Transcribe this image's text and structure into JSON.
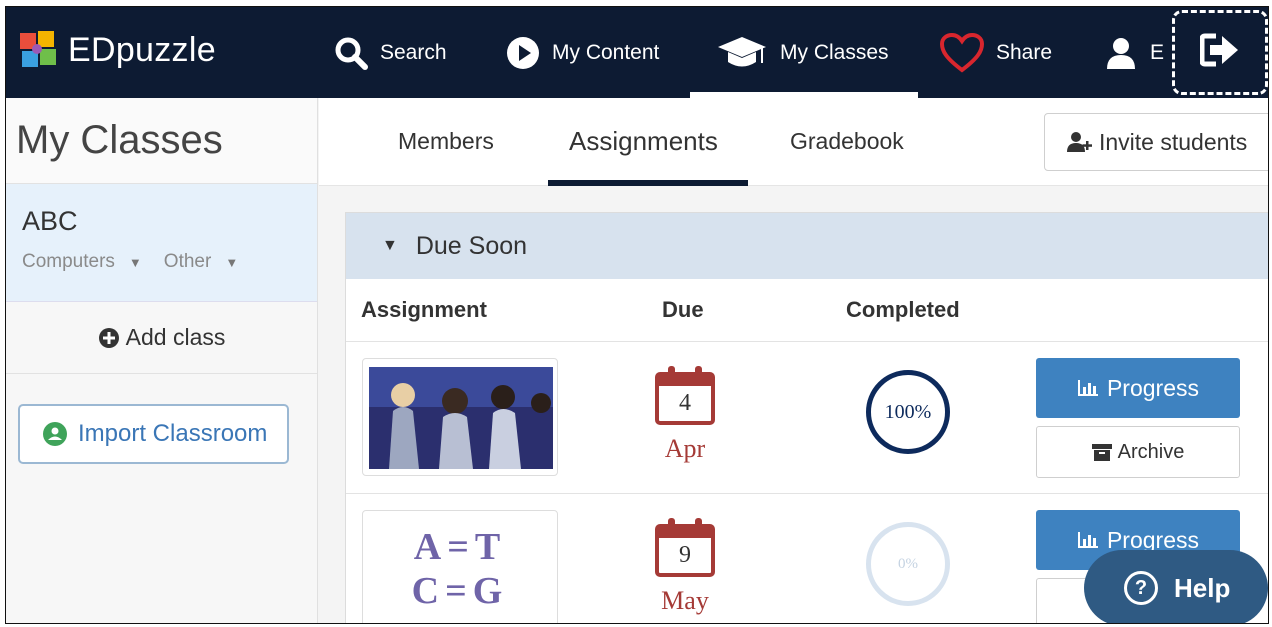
{
  "app": {
    "brand": "EDpuzzle"
  },
  "topnav": {
    "search": "Search",
    "my_content": "My Content",
    "my_classes": "My Classes",
    "share": "Share",
    "user_initial": "E"
  },
  "sidebar": {
    "title": "My Classes",
    "class_name": "ABC",
    "class_tag_1": "Computers",
    "class_tag_2": "Other",
    "add_class": "Add class",
    "import_classroom": "Import Classroom"
  },
  "tabs": {
    "members": "Members",
    "assignments": "Assignments",
    "gradebook": "Gradebook",
    "invite": "Invite students"
  },
  "panel": {
    "section": "Due Soon",
    "col_assignment": "Assignment",
    "col_due": "Due",
    "col_completed": "Completed",
    "rows": [
      {
        "due_day": "4",
        "due_month": "Apr",
        "completed": "100%",
        "completed_fraction": 1.0,
        "progress": "Progress",
        "archive": "Archive"
      },
      {
        "due_day": "9",
        "due_month": "May",
        "completed": "0%",
        "completed_fraction": 0.0,
        "progress": "Progress",
        "thumb_line_1": "A=T",
        "thumb_line_2": "C=G"
      }
    ]
  },
  "help": {
    "label": "Help"
  },
  "colors": {
    "nav_bg": "#0d1b33",
    "accent_blue": "#3e82c0",
    "calendar_red": "#a53a36",
    "help_bg": "#2f5a83"
  }
}
